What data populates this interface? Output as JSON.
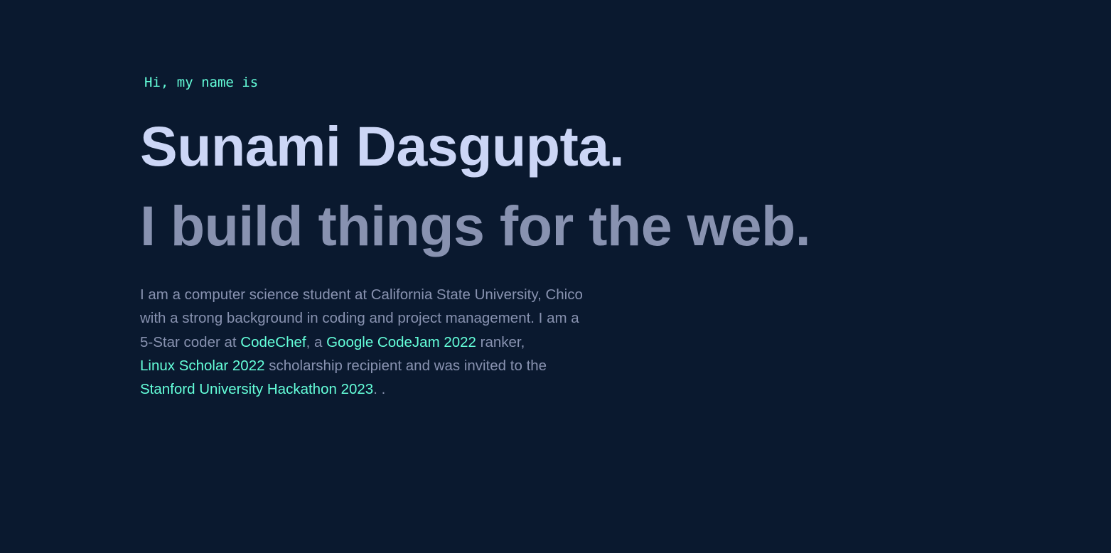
{
  "hero": {
    "greeting": "Hi, my name is",
    "name": "Sunami Dasgupta.",
    "tagline": "I build things for the web."
  },
  "bio": {
    "line1": "I am a computer science student at California State University, Chico",
    "line2": "with a strong background in coding and project management. I am a",
    "line3_pre": "5-Star coder at ",
    "link_codechef": "CodeChef",
    "line3_mid": ", a ",
    "link_codejam": "Google CodeJam 2022",
    "line3_post": " ranker,",
    "link_linux": "Linux Scholar 2022",
    "line4_post": " scholarship recipient and was invited to the",
    "link_stanford": "Stanford University Hackathon 2023",
    "line5_post": ". ."
  },
  "colors": {
    "background": "#0a192f",
    "accent": "#64ffda",
    "heading": "#ccd6f6",
    "muted": "#8892b0"
  }
}
